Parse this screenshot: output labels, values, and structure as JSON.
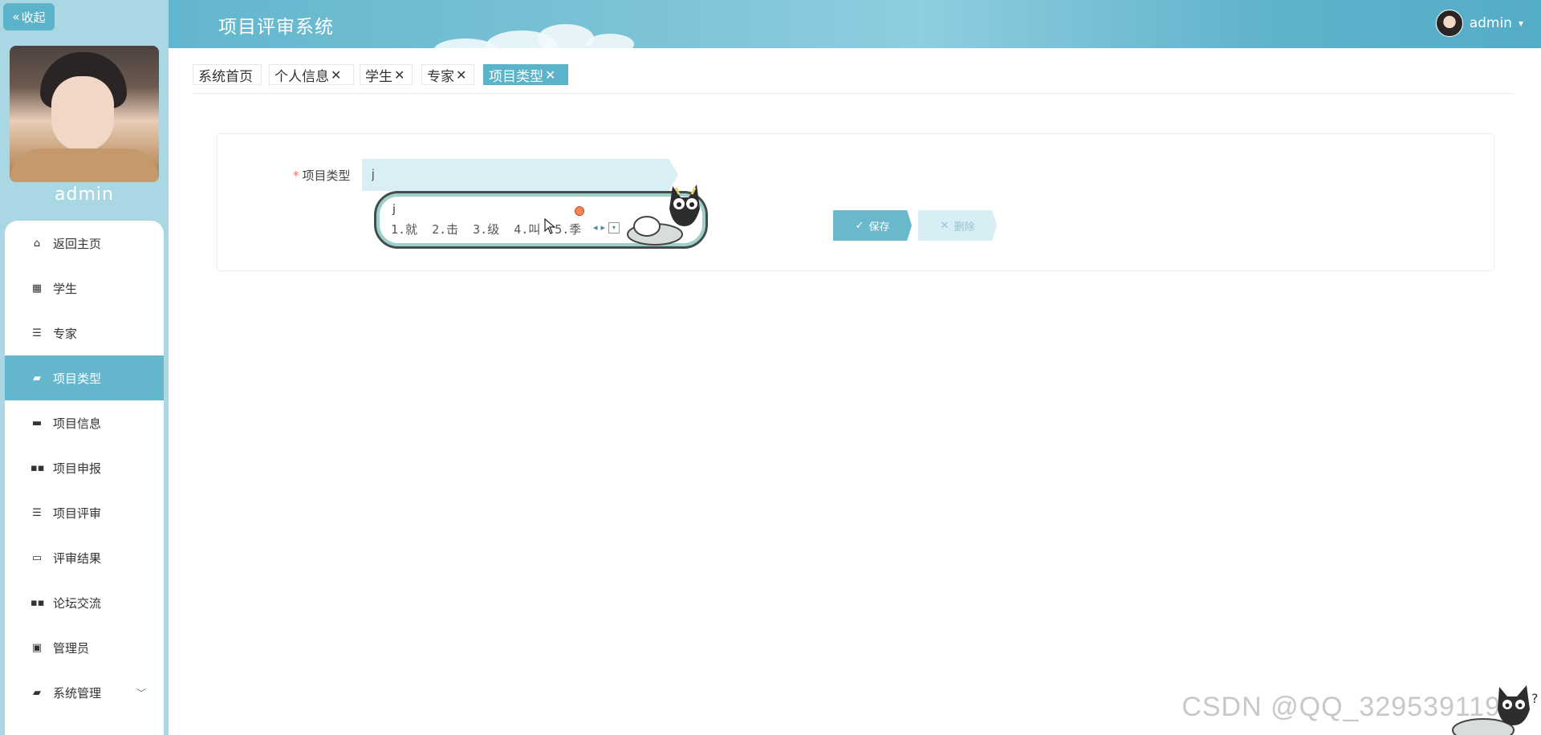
{
  "sidebar": {
    "collapse_label": "收起",
    "username": "admin",
    "items": [
      {
        "label": "返回主页",
        "icon": "home-icon"
      },
      {
        "label": "学生",
        "icon": "grid-icon"
      },
      {
        "label": "专家",
        "icon": "list-icon"
      },
      {
        "label": "项目类型",
        "icon": "briefcase-icon",
        "active": true
      },
      {
        "label": "项目信息",
        "icon": "monitor-icon"
      },
      {
        "label": "项目申报",
        "icon": "apps-icon"
      },
      {
        "label": "项目评审",
        "icon": "list-icon"
      },
      {
        "label": "评审结果",
        "icon": "comment-icon"
      },
      {
        "label": "论坛交流",
        "icon": "apps-icon"
      },
      {
        "label": "管理员",
        "icon": "clipboard-icon"
      },
      {
        "label": "系统管理",
        "icon": "briefcase-icon",
        "expandable": true
      }
    ]
  },
  "header": {
    "title": "项目评审系统",
    "user": "admin"
  },
  "tabs": [
    {
      "label": "系统首页",
      "closable": false
    },
    {
      "label": "个人信息",
      "closable": true
    },
    {
      "label": "学生",
      "closable": true
    },
    {
      "label": "专家",
      "closable": true
    },
    {
      "label": "项目类型",
      "closable": true,
      "active": true
    }
  ],
  "form": {
    "required_mark": "*",
    "label": "项目类型",
    "value": "j",
    "save_label": "保存",
    "delete_label": "删除"
  },
  "ime": {
    "composition": "j",
    "candidates": [
      "1.就",
      "2.击",
      "3.级",
      "4.叫",
      "5.季"
    ]
  },
  "watermark": "CSDN @QQ_3295391197",
  "colors": {
    "accent": "#5ab3c9",
    "sidebar_bg": "#a9d8e4",
    "required": "#f56c6c",
    "input_bg": "#d9eff5"
  }
}
